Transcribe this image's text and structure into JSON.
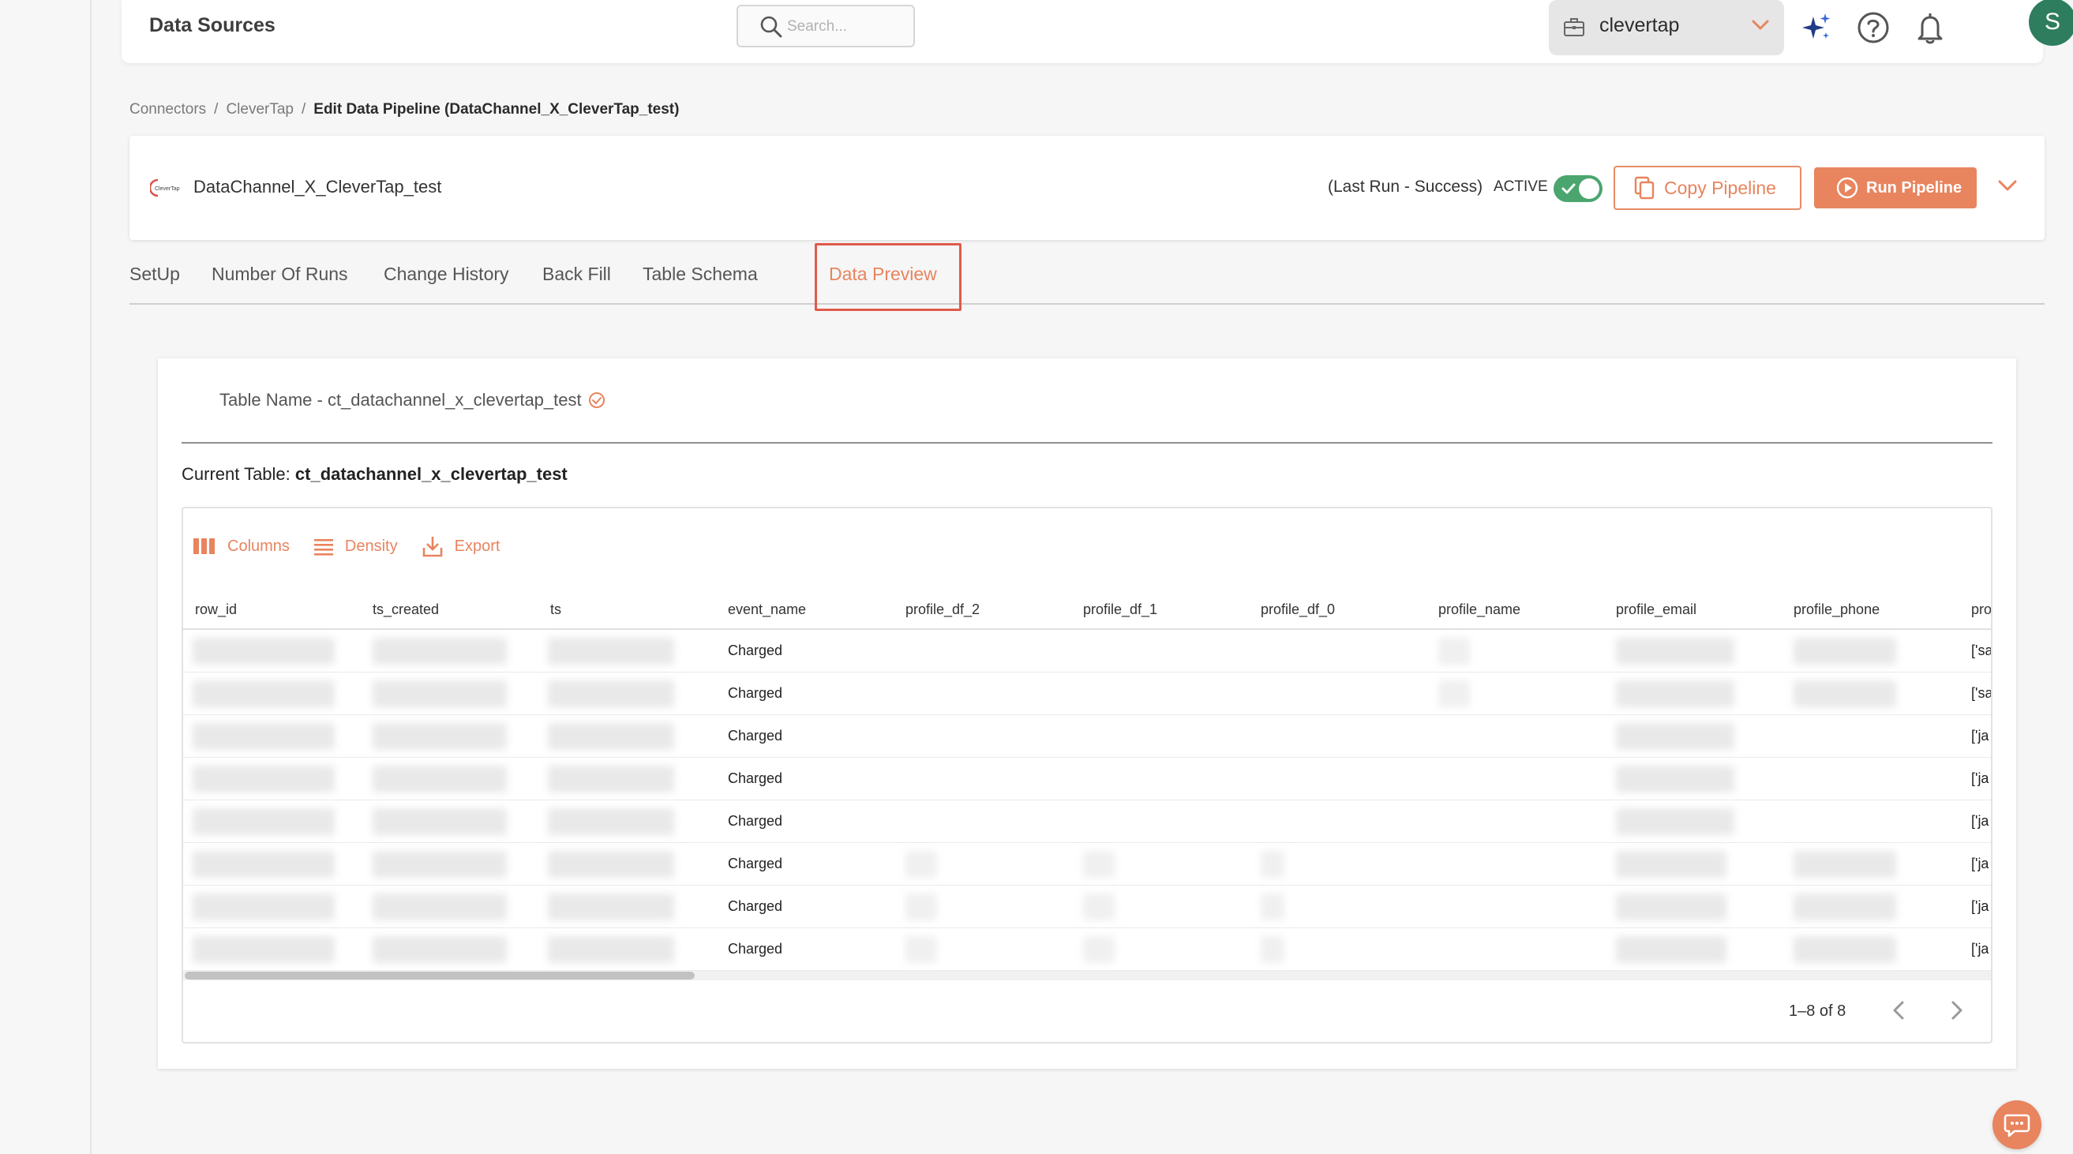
{
  "header": {
    "title": "Data Sources",
    "search_placeholder": "Search...",
    "workspace": "clevertap",
    "avatar_initial": "S"
  },
  "breadcrumb": {
    "items": [
      "Connectors",
      "CleverTap"
    ],
    "current": "Edit Data Pipeline  (DataChannel_X_CleverTap_test)"
  },
  "pipeline": {
    "logo_text": "CleverTap",
    "name": "DataChannel_X_CleverTap_test",
    "last_run": "(Last Run - Success)",
    "status": "ACTIVE",
    "active": true,
    "copy_label": "Copy Pipeline",
    "run_label": "Run Pipeline"
  },
  "tabs": [
    "SetUp",
    "Number Of Runs",
    "Change History",
    "Back Fill",
    "Table Schema",
    "Data Preview"
  ],
  "active_tab": "Data Preview",
  "preview": {
    "table_name": "Table Name - ct_datachannel_x_clevertap_test",
    "current_table_label": "Current Table:",
    "current_table_value": "ct_datachannel_x_clevertap_test",
    "toolbar": {
      "columns": "Columns",
      "density": "Density",
      "export": "Export"
    },
    "columns": [
      "row_id",
      "ts_created",
      "ts",
      "event_name",
      "profile_df_2",
      "profile_df_1",
      "profile_df_0",
      "profile_name",
      "profile_email",
      "profile_phone",
      "pro"
    ],
    "rows": [
      {
        "event_name": "Charged",
        "last": "['sa"
      },
      {
        "event_name": "Charged",
        "last": "['sa"
      },
      {
        "event_name": "Charged",
        "last": "['ja"
      },
      {
        "event_name": "Charged",
        "last": "['ja"
      },
      {
        "event_name": "Charged",
        "last": "['ja"
      },
      {
        "event_name": "Charged",
        "last": "['ja"
      },
      {
        "event_name": "Charged",
        "last": "['ja"
      },
      {
        "event_name": "Charged",
        "last": "['ja"
      }
    ],
    "pagination": "1–8 of 8"
  },
  "colors": {
    "accent": "#e8845e",
    "active_green": "#4aa56e",
    "avatar": "#2e7d5e",
    "highlight": "#e05a4a"
  }
}
